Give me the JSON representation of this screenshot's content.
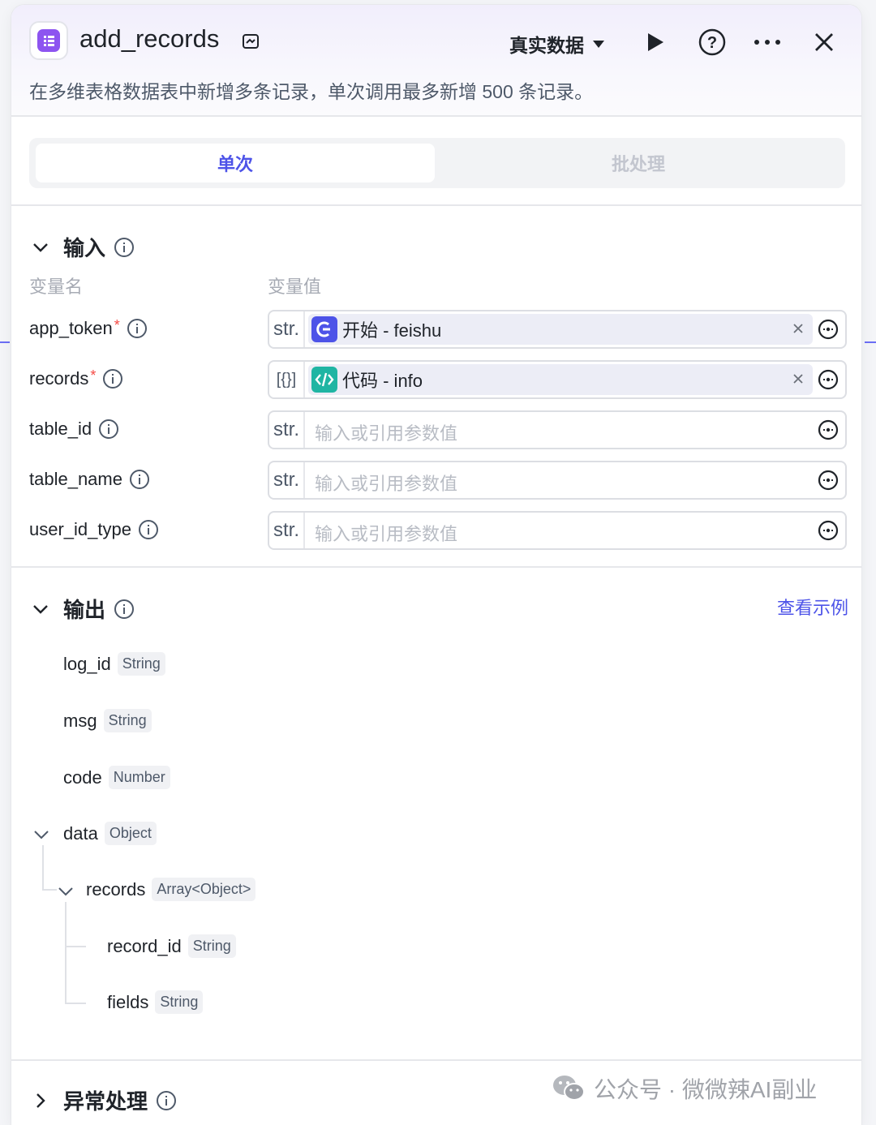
{
  "header": {
    "title": "add_records",
    "mode_label": "真实数据",
    "description": "在多维表格数据表中新增多条记录，单次调用最多新增 500 条记录。"
  },
  "tabs": [
    {
      "label": "单次",
      "active": true
    },
    {
      "label": "批处理",
      "active": false
    }
  ],
  "input_section": {
    "title": "输入",
    "col_name": "变量名",
    "col_value": "变量值",
    "rows": [
      {
        "name": "app_token",
        "required": true,
        "type": "str.",
        "ref_icon": "start-node-icon",
        "ref_text": "开始 - feishu",
        "placeholder": ""
      },
      {
        "name": "records",
        "required": true,
        "type": "[{}]",
        "ref_icon": "code-node-icon",
        "ref_text": "代码 - info",
        "placeholder": ""
      },
      {
        "name": "table_id",
        "required": false,
        "type": "str.",
        "ref_text": "",
        "placeholder": "输入或引用参数值"
      },
      {
        "name": "table_name",
        "required": false,
        "type": "str.",
        "ref_text": "",
        "placeholder": "输入或引用参数值"
      },
      {
        "name": "user_id_type",
        "required": false,
        "type": "str.",
        "ref_text": "",
        "placeholder": "输入或引用参数值"
      }
    ],
    "required_mark": "*"
  },
  "output_section": {
    "title": "输出",
    "example_link": "查看示例",
    "fields": [
      {
        "name": "log_id",
        "type": "String"
      },
      {
        "name": "msg",
        "type": "String"
      },
      {
        "name": "code",
        "type": "Number"
      },
      {
        "name": "data",
        "type": "Object"
      },
      {
        "name": "records",
        "type": "Array<Object>"
      },
      {
        "name": "record_id",
        "type": "String"
      },
      {
        "name": "fields",
        "type": "String"
      }
    ]
  },
  "error_section": {
    "title": "异常处理"
  },
  "watermark": "公众号 · 微微辣AI副业",
  "colors": {
    "accent": "#4d53e8",
    "app_icon": "#8d54f0",
    "start_icon": "#4d53e8",
    "code_icon": "#1fb5a3",
    "required": "#f54a45"
  }
}
